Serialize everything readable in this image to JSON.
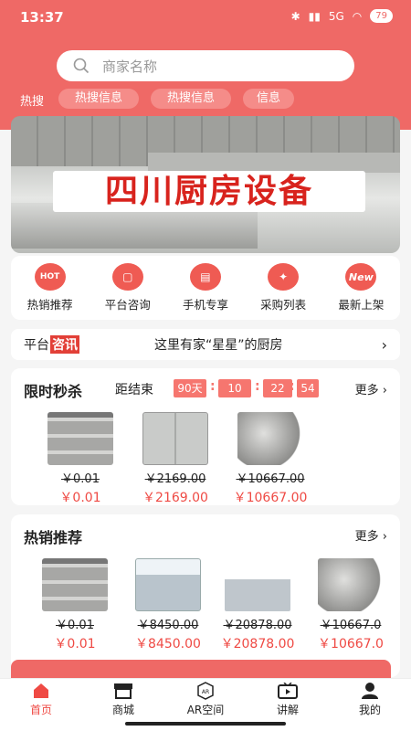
{
  "status": {
    "time": "13:37",
    "network": "5G",
    "battery": "79"
  },
  "search": {
    "placeholder": "商家名称"
  },
  "hot": {
    "label": "热搜",
    "chips": [
      "热搜信息",
      "热搜信息",
      "信息"
    ]
  },
  "banner": {
    "title": "四川厨房设备"
  },
  "menu": [
    {
      "label": "热销推荐",
      "icon": "hot-badge-icon",
      "glyph": "HOT"
    },
    {
      "label": "平台咨询",
      "icon": "consult-icon",
      "glyph": "▢"
    },
    {
      "label": "手机专享",
      "icon": "phone-icon",
      "glyph": "▤"
    },
    {
      "label": "采购列表",
      "icon": "shopping-run-icon",
      "glyph": "✦"
    },
    {
      "label": "最新上架",
      "icon": "new-badge-icon",
      "glyph": "New"
    }
  ],
  "news": {
    "prefix": "平台",
    "highlight": "咨讯",
    "text": "这里有家“星星”的厨房"
  },
  "flash_sale": {
    "title": "限时秒杀",
    "countdown_label": "距结束",
    "days": "90天",
    "hours": "10",
    "minutes": "22",
    "seconds": "54",
    "more": "更多",
    "products": [
      {
        "old": "￥0.01",
        "price": "￥0.01",
        "image": "oven"
      },
      {
        "old": "￥2169.00",
        "price": "￥2169.00",
        "image": "fridge"
      },
      {
        "old": "￥10667.00",
        "price": "￥10667.00",
        "image": "machine"
      }
    ]
  },
  "hot_sale": {
    "title": "热销推荐",
    "more": "更多",
    "products": [
      {
        "old": "￥0.01",
        "price": "￥0.01",
        "image": "oven"
      },
      {
        "old": "￥8450.00",
        "price": "￥8450.00",
        "image": "stove"
      },
      {
        "old": "￥20878.00",
        "price": "￥20878.00",
        "image": "dish"
      },
      {
        "old": "￥10667.0",
        "price": "￥10667.0",
        "image": "machine"
      }
    ]
  },
  "tabs": [
    {
      "label": "首页",
      "icon": "home-icon",
      "active": true
    },
    {
      "label": "商城",
      "icon": "shop-icon"
    },
    {
      "label": "AR空间",
      "icon": "ar-icon"
    },
    {
      "label": "讲解",
      "icon": "video-icon"
    },
    {
      "label": "我的",
      "icon": "user-icon"
    }
  ],
  "colors": {
    "brand": "#ef6966",
    "price": "#ef4a44"
  }
}
